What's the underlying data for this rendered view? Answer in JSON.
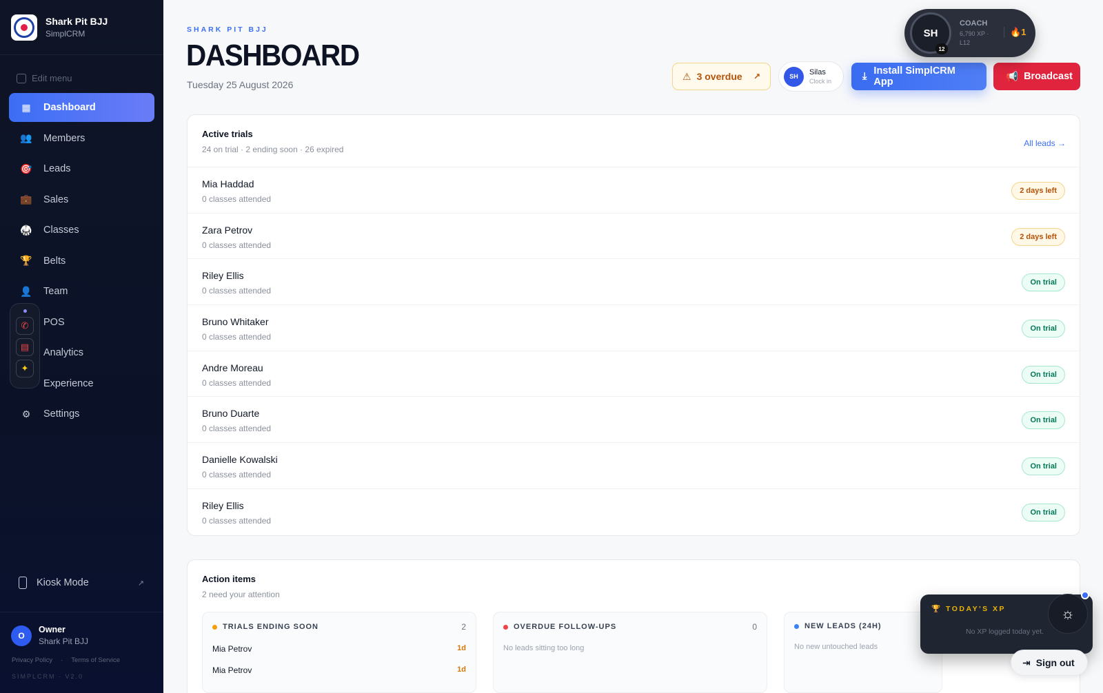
{
  "brand": {
    "name": "Shark Pit BJJ",
    "sub": "SimplCRM"
  },
  "sidebar": {
    "edit_menu": "Edit menu",
    "items": [
      {
        "label": "Dashboard",
        "icon": "grid-icon"
      },
      {
        "label": "Members",
        "icon": "members-icon"
      },
      {
        "label": "Leads",
        "icon": "target-icon"
      },
      {
        "label": "Sales",
        "icon": "briefcase-icon"
      },
      {
        "label": "Classes",
        "icon": "gi-icon"
      },
      {
        "label": "Belts",
        "icon": "trophy-icon"
      },
      {
        "label": "Team",
        "icon": "person-icon"
      },
      {
        "label": "POS",
        "icon": "pos-icon"
      },
      {
        "label": "Analytics",
        "icon": "analytics-icon"
      },
      {
        "label": "Experience",
        "icon": "experience-icon"
      },
      {
        "label": "Settings",
        "icon": "gear-icon"
      }
    ],
    "kiosk": "Kiosk Mode",
    "owner": {
      "initial": "O",
      "role": "Owner",
      "gym": "Shark Pit BJJ"
    },
    "legal": {
      "privacy": "Privacy Policy",
      "sep": "·",
      "terms": "Terms of Service"
    },
    "version": "SIMPLCRM · V2.0"
  },
  "header": {
    "eyebrow": "SHARK PIT BJJ",
    "title": "DASHBOARD",
    "date": "Tuesday 25 August 2026",
    "overdue": "3 overdue",
    "clockin": {
      "initials": "SH",
      "name": "Silas",
      "action": "Clock in"
    },
    "install": "Install SimplCRM App",
    "broadcast": "Broadcast"
  },
  "coach": {
    "initials": "SH",
    "level": "12",
    "role": "COACH",
    "xp": "6,790 XP · L12",
    "streak": "1"
  },
  "trials": {
    "title": "Active trials",
    "subtitle": "24 on trial · 2 ending soon · 26 expired",
    "link": "All leads →",
    "rows": [
      {
        "name": "Mia Haddad",
        "sub": "0 classes attended",
        "status": "2 days left",
        "kind": "warn"
      },
      {
        "name": "Zara Petrov",
        "sub": "0 classes attended",
        "status": "2 days left",
        "kind": "warn"
      },
      {
        "name": "Riley Ellis",
        "sub": "0 classes attended",
        "status": "On trial",
        "kind": "ok"
      },
      {
        "name": "Bruno Whitaker",
        "sub": "0 classes attended",
        "status": "On trial",
        "kind": "ok"
      },
      {
        "name": "Andre Moreau",
        "sub": "0 classes attended",
        "status": "On trial",
        "kind": "ok"
      },
      {
        "name": "Bruno Duarte",
        "sub": "0 classes attended",
        "status": "On trial",
        "kind": "ok"
      },
      {
        "name": "Danielle Kowalski",
        "sub": "0 classes attended",
        "status": "On trial",
        "kind": "ok"
      },
      {
        "name": "Riley Ellis",
        "sub": "0 classes attended",
        "status": "On trial",
        "kind": "ok"
      }
    ]
  },
  "actions": {
    "title": "Action items",
    "subtitle": "2 need your attention",
    "trials_soon": {
      "label": "TRIALS ENDING SOON",
      "count": "2",
      "color": "#f59e0b",
      "items": [
        {
          "name": "Mia Petrov",
          "due": "1d"
        },
        {
          "name": "Mia Petrov",
          "due": "1d"
        }
      ]
    },
    "overdue": {
      "label": "OVERDUE FOLLOW-UPS",
      "count": "0",
      "color": "#ef4444",
      "empty": "No leads sitting too long"
    },
    "new_leads": {
      "label": "NEW LEADS (24H)",
      "color": "#3b82f6",
      "empty": "No new untouched leads"
    }
  },
  "xp_panel": {
    "title": "TODAY'S XP",
    "message": "No XP logged today yet."
  },
  "signout": "Sign out"
}
